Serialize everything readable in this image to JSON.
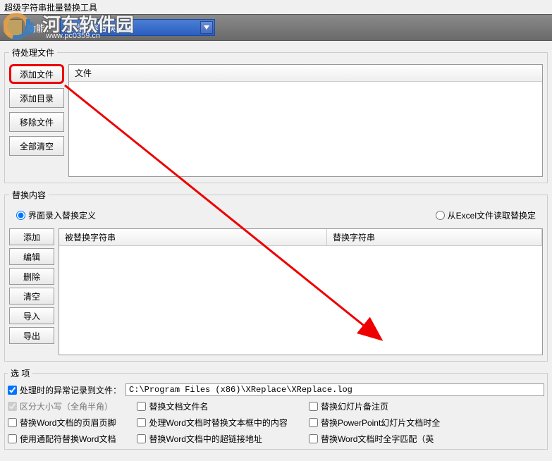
{
  "window": {
    "title": "超级字符串批量替换工具"
  },
  "watermark": {
    "main": "河东软件园",
    "sub": "www.pc0359.cn"
  },
  "toolbar": {
    "label": "功能：",
    "dropdown_value": "文档内容替换"
  },
  "files": {
    "legend": "待处理文件",
    "header": "文件",
    "buttons": {
      "add_file": "添加文件",
      "add_dir": "添加目录",
      "remove": "移除文件",
      "clear_all": "全部清空"
    }
  },
  "replace": {
    "legend": "替换内容",
    "radio_ui": "界面录入替换定义",
    "radio_excel": "从Excel文件读取替换定",
    "col_search": "被替换字符串",
    "col_replace": "替换字符串",
    "buttons": {
      "add": "添加",
      "edit": "编辑",
      "delete": "删除",
      "clear": "清空",
      "import": "导入",
      "export": "导出"
    }
  },
  "options": {
    "legend": "选  项",
    "log_label": "处理时的异常记录到文件：",
    "log_path": "C:\\Program Files (x86)\\XReplace\\XReplace.log",
    "case_sensitive": "区分大小写（全角半角）",
    "word_header": "替换Word文档的页眉页脚",
    "wildcard_word": "使用通配符替换Word文档",
    "replace_filename": "替换文档文件名",
    "word_textbox": "处理Word文档时替换文本框中的内容",
    "word_hyperlink": "替换Word文档中的超链接地址",
    "ppt_notes": "替换幻灯片备注页",
    "ppt_header": "替换PowerPoint幻灯片文档时全",
    "word_fullmatch": "替换Word文档时全字匹配（英"
  }
}
